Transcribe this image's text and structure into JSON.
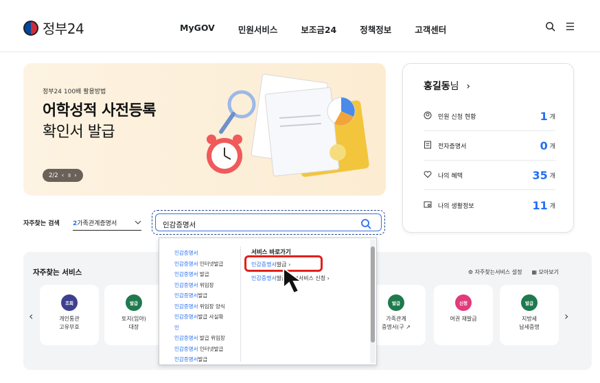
{
  "header": {
    "logo_text": "정부24",
    "nav": [
      "MyGOV",
      "민원서비스",
      "보조금24",
      "정책정보",
      "고객센터"
    ],
    "search_icon": "search-icon",
    "menu_icon": "hamburger-menu-icon"
  },
  "banner": {
    "subtitle": "정부24 100배 활용방법",
    "title_line1": "어학성적 사전등록",
    "title_line2": "확인서 발급",
    "pager": "2/2",
    "pager_prev": "‹",
    "pager_pause": "॥",
    "pager_next": "›"
  },
  "user": {
    "name": "홍길동",
    "suffix": "님",
    "arrow": "›",
    "stats": [
      {
        "icon": "person-circle-icon",
        "label": "민원 신청 현황",
        "count": "1",
        "unit": "개"
      },
      {
        "icon": "document-icon",
        "label": "전자증명서",
        "count": "0",
        "unit": "개"
      },
      {
        "icon": "heart-icon",
        "label": "나의 혜택",
        "count": "35",
        "unit": "개"
      },
      {
        "icon": "info-card-icon",
        "label": "나의 생활정보",
        "count": "11",
        "unit": "개"
      }
    ]
  },
  "search": {
    "fav_label": "자주찾는 검색",
    "fav_num": "2",
    "fav_value": "가족관계증명서",
    "query": "인감증명서"
  },
  "services": {
    "title": "자주찾는 서비스",
    "settings": "자주찾는서비스 설정",
    "view_all": "모아보기",
    "tiles": [
      {
        "badge": "조회",
        "color": "#3d3f8f",
        "label_1": "개인통관",
        "label_2": "고유부호"
      },
      {
        "badge": "발급",
        "color": "#1f7a4d",
        "label_1": "토지(임야)",
        "label_2": "대장"
      },
      {
        "badge": "발급",
        "color": "#1f7a4d",
        "label_1": "가족관계",
        "label_2": "증명서(구"
      },
      {
        "badge": "신청",
        "color": "#e23a7a",
        "label_1": "여권 재발급",
        "label_2": ""
      },
      {
        "badge": "발급",
        "color": "#1f7a4d",
        "label_1": "지방세",
        "label_2": "납세증명"
      }
    ]
  },
  "dropdown": {
    "suggestions": [
      {
        "match": "인감증명서",
        "rest": ""
      },
      {
        "match": "인감증명서",
        "rest": " 인터넷발급"
      },
      {
        "match": "인감증명서",
        "rest": " 발급"
      },
      {
        "match": "인감증명서",
        "rest": " 위임장"
      },
      {
        "match": "인감증명서",
        "rest": "발급"
      },
      {
        "match": "인감증명서",
        "rest": " 위임장 양식"
      },
      {
        "match": "인감증명서",
        "rest": "발급 사실확"
      },
      {
        "match": "인",
        "rest": ""
      },
      {
        "match": "인감증명서",
        "rest": " 발급 위임장"
      },
      {
        "match": "인감증명서",
        "rest": " 인터넷발급"
      },
      {
        "match": "인감증명서",
        "rest": "발급"
      }
    ],
    "shortcut_title": "서비스 바로가기",
    "shortcuts": [
      {
        "match": "인감증명서",
        "rest": "발급 ›"
      },
      {
        "match": "인감증명서",
        "rest": "발급 정보서비스 신청 ›"
      }
    ]
  }
}
